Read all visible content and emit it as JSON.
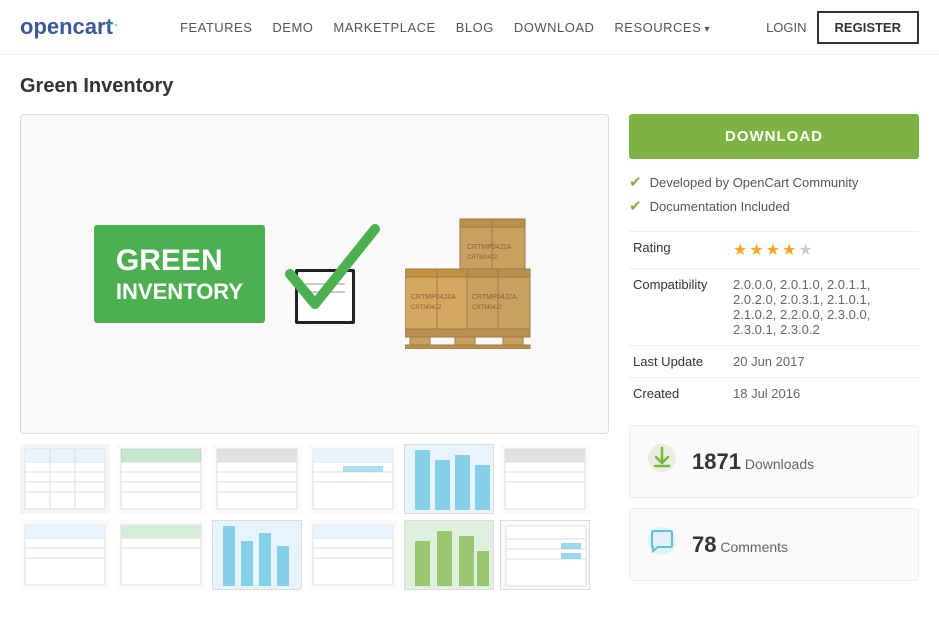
{
  "navbar": {
    "logo_text": "opencart",
    "logo_cart_symbol": "≡≡",
    "links": [
      {
        "label": "FEATURES",
        "id": "features"
      },
      {
        "label": "DEMO",
        "id": "demo"
      },
      {
        "label": "MARKETPLACE",
        "id": "marketplace"
      },
      {
        "label": "BLOG",
        "id": "blog"
      },
      {
        "label": "DOWNLOAD",
        "id": "download"
      },
      {
        "label": "RESOURCES",
        "id": "resources",
        "hasDropdown": true
      }
    ],
    "login_label": "LOGIN",
    "register_label": "REGISTER"
  },
  "page": {
    "title": "Green Inventory"
  },
  "sidebar": {
    "download_btn_label": "DOWNLOAD",
    "features": [
      "Developed by OpenCart Community",
      "Documentation Included"
    ],
    "rating_label": "Rating",
    "stars_filled": 3,
    "stars_half": 1,
    "stars_empty": 1,
    "compatibility_label": "Compatibility",
    "compatibility_value": "2.0.0.0, 2.0.1.0, 2.0.1.1, 2.0.2.0, 2.0.3.1, 2.1.0.1, 2.1.0.2, 2.2.0.0, 2.3.0.0, 2.3.0.1, 2.3.0.2",
    "last_update_label": "Last Update",
    "last_update_value": "20 Jun 2017",
    "created_label": "Created",
    "created_value": "18 Jul 2016",
    "downloads_count": "1871",
    "downloads_label": "Downloads",
    "comments_count": "78",
    "comments_label": "Comments"
  },
  "thumbnails": [
    {
      "id": 1,
      "type": "table"
    },
    {
      "id": 2,
      "type": "table"
    },
    {
      "id": 3,
      "type": "table"
    },
    {
      "id": 4,
      "type": "table"
    },
    {
      "id": 5,
      "type": "blue"
    },
    {
      "id": 6,
      "type": "table"
    },
    {
      "id": 7,
      "type": "table"
    },
    {
      "id": 8,
      "type": "table"
    },
    {
      "id": 9,
      "type": "blue"
    },
    {
      "id": 10,
      "type": "table"
    },
    {
      "id": 11,
      "type": "blue"
    },
    {
      "id": 12,
      "type": "blue"
    }
  ]
}
